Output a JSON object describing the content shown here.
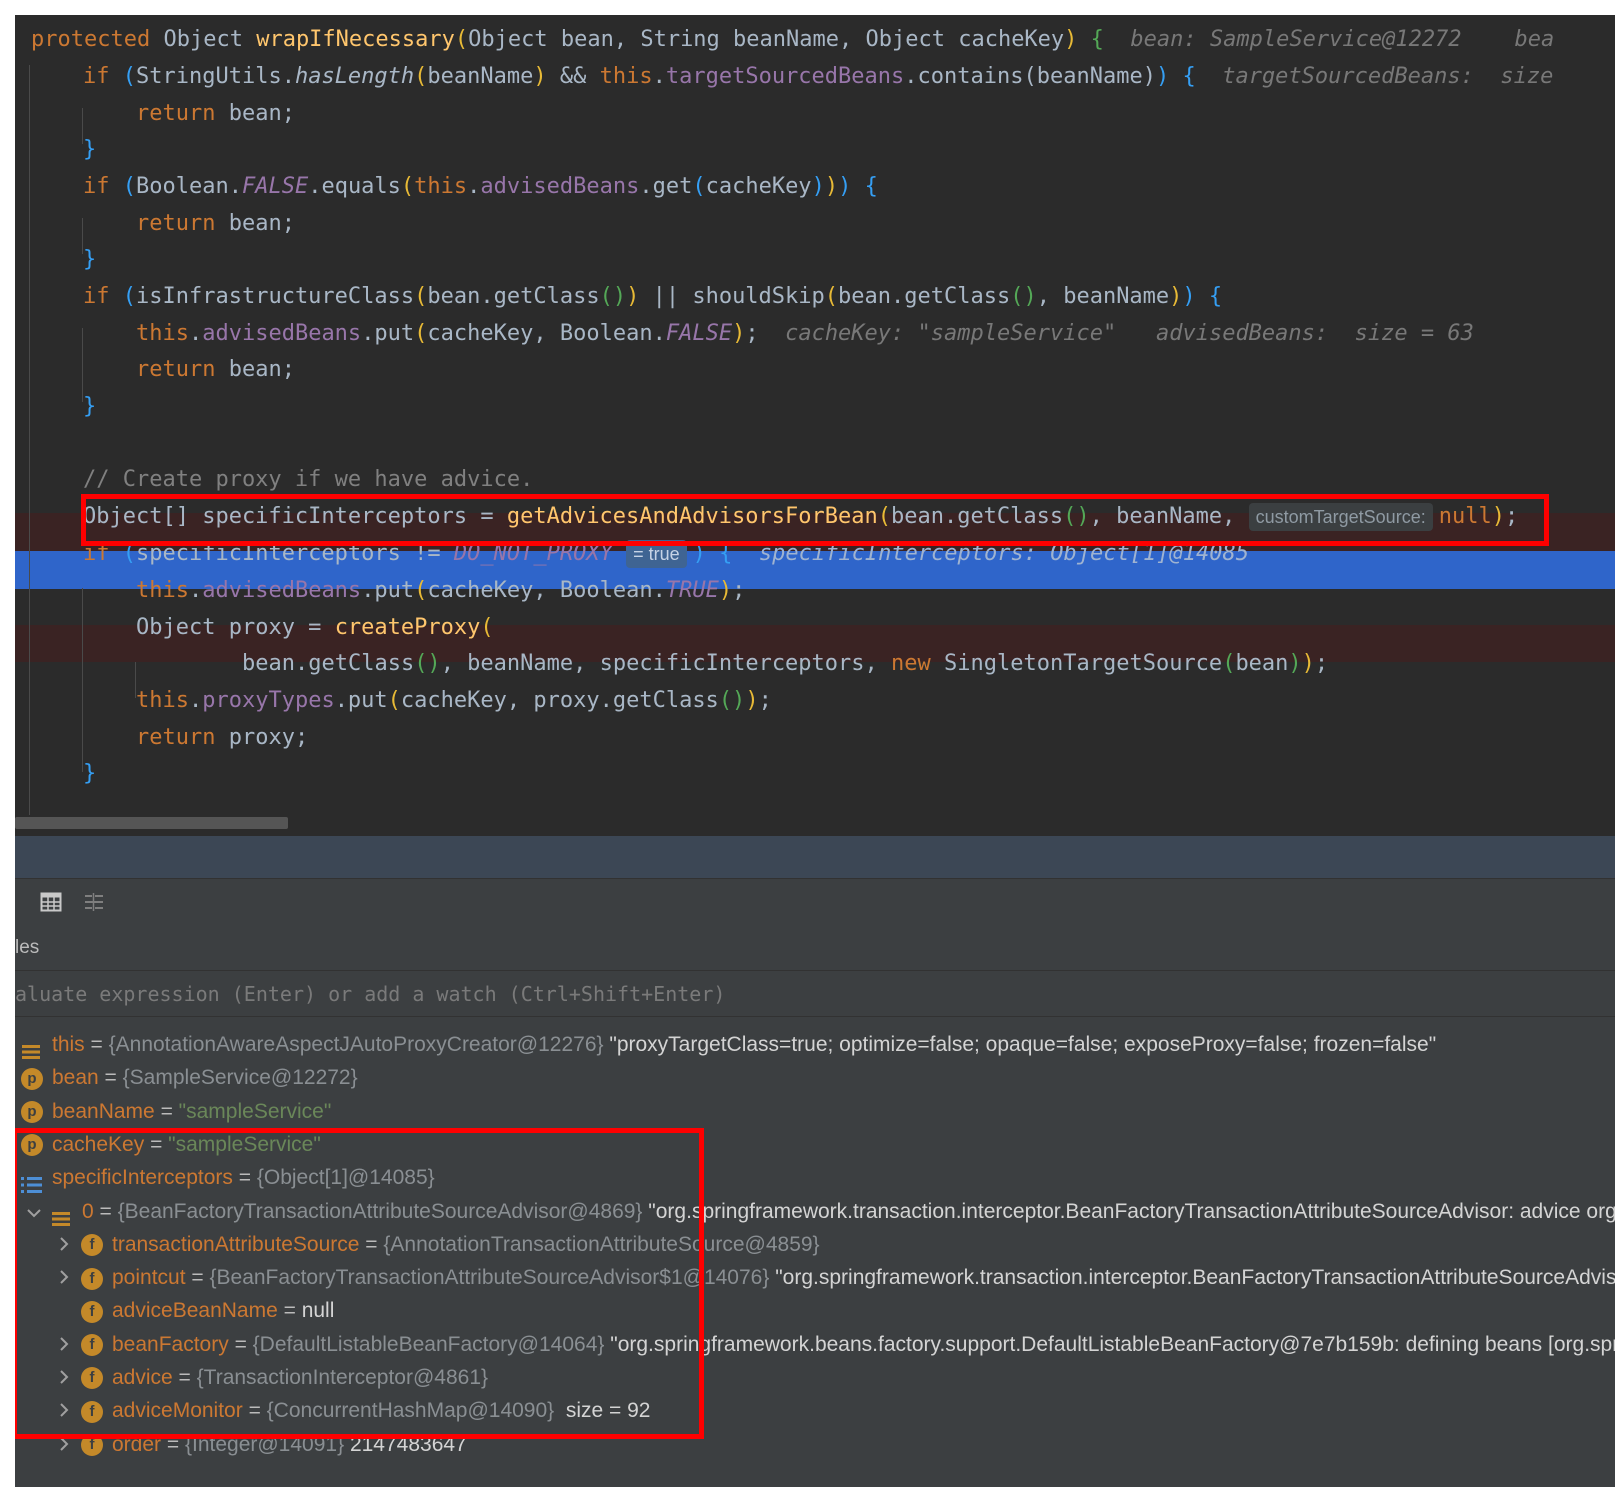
{
  "editor": {
    "line_method": {
      "kw_protected": "protected",
      "type_object": "Object",
      "method_name": "wrapIfNecessary",
      "params": "Object bean, String beanName, Object cacheKey",
      "open": "{",
      "hint_bean": "bean: SampleService@12272",
      "hint_more": "bea"
    },
    "line_if1": {
      "kw_if": "if",
      "cls": "StringUtils.",
      "method": "hasLength",
      "arg": "beanName",
      "andand": " && ",
      "this": "this",
      "field": "targetSourcedBeans",
      "call": ".contains(",
      "arg2": "beanName",
      "hint": "targetSourcedBeans:  size"
    },
    "return_kw": "return",
    "return_bean": " bean;",
    "return_proxy": " proxy;",
    "close_brace": "}",
    "line_if2": {
      "kw_if": "if",
      "cls": "Boolean.",
      "const_false": "FALSE",
      "equals": ".equals",
      "this": "this",
      "field": "advisedBeans",
      "get": ".get",
      "arg": "cacheKey"
    },
    "line_if3": {
      "kw_if": "if",
      "m1": "isInfrastructureClass",
      "getclass": "bean.getClass",
      "or": " || ",
      "m2": "shouldSkip",
      "sep": ", beanName"
    },
    "line_put_false": {
      "this": "this",
      "field": "advisedBeans",
      "put": ".put",
      "args": "cacheKey, Boolean.",
      "const": "FALSE",
      "hint1": "cacheKey: \"sampleService\"",
      "hint2": "advisedBeans:  size = 63"
    },
    "comment": "// Create proxy if we have advice.",
    "line_specific": {
      "decl": "Object[] specificInterceptors = ",
      "method": "getAdvicesAndAdvisorsForBean",
      "args": "bean.getClass",
      "args2": "beanName",
      "param_hint": "customTargetSource:",
      "null_kw": "null",
      "end": ";"
    },
    "line_if4": {
      "kw_if": "if",
      "var": "specificInterceptors != ",
      "const": "DO_NOT_PROXY",
      "eval_pill": "= true",
      "open": "{",
      "hint": "specificInterceptors: Object[1]@14085"
    },
    "line_put_true": {
      "this": "this",
      "field": "advisedBeans",
      "put": ".put",
      "args": "cacheKey, Boolean.",
      "const": "TRUE"
    },
    "line_create": {
      "decl": "Object proxy = ",
      "method": "createProxy"
    },
    "line_create_args": {
      "a1": "bean.getClass",
      "a2": ", beanName, specificInterceptors, ",
      "new_kw": "new",
      "cls": " SingletonTargetSource",
      "arg": "bean"
    },
    "line_proxytypes": {
      "this": "this",
      "field": "proxyTypes",
      "put": ".put",
      "a1": "cacheKey, proxy.getClass"
    }
  },
  "debugger": {
    "tab_label": "les",
    "eval_placeholder": "aluate expression (Enter) or add a watch (Ctrl+Shift+Enter)",
    "variables": [
      {
        "name": "this",
        "type": "{AnnotationAwareAspectJAutoProxyCreator@12276}",
        "value": "\"proxyTargetClass=true; optimize=false; opaque=false; exposeProxy=false; frozen=false\"",
        "icon": "lines-icon"
      },
      {
        "name": "bean",
        "type": "{SampleService@12272}",
        "value": "",
        "icon": "p-badge",
        "badge": "p"
      },
      {
        "name": "beanName",
        "type": "",
        "value": "\"sampleService\"",
        "icon": "p-badge",
        "badge": "p"
      },
      {
        "name": "cacheKey",
        "type": "",
        "value": "\"sampleService\"",
        "icon": "p-badge",
        "badge": "p"
      },
      {
        "name": "specificInterceptors",
        "type": "{Object[1]@14085}",
        "value": "",
        "icon": "array-icon"
      },
      {
        "name": "0",
        "type": "{BeanFactoryTransactionAttributeSourceAdvisor@4869}",
        "value": "\"org.springframework.transaction.interceptor.BeanFactoryTransactionAttributeSourceAdvisor: advice org.s",
        "icon": "lines-icon"
      },
      {
        "name": "transactionAttributeSource",
        "type": "{AnnotationTransactionAttributeSource@4859}",
        "value": "",
        "icon": "f-badge",
        "badge": "f"
      },
      {
        "name": "pointcut",
        "type": "{BeanFactoryTransactionAttributeSourceAdvisor$1@14076}",
        "value": "\"org.springframework.transaction.interceptor.BeanFactoryTransactionAttributeSourceAdviso",
        "icon": "f-badge",
        "badge": "f"
      },
      {
        "name": "adviceBeanName",
        "type": "",
        "value": "null",
        "icon": "f-badge",
        "badge": "f"
      },
      {
        "name": "beanFactory",
        "type": "{DefaultListableBeanFactory@14064}",
        "value": "\"org.springframework.beans.factory.support.DefaultListableBeanFactory@7e7b159b: defining beans [org.spri",
        "icon": "f-badge",
        "badge": "f"
      },
      {
        "name": "advice",
        "type": "{TransactionInterceptor@4861}",
        "value": "",
        "icon": "f-badge",
        "badge": "f"
      },
      {
        "name": "adviceMonitor",
        "type": "{ConcurrentHashMap@14090}",
        "value": " size = 92",
        "icon": "f-badge",
        "badge": "f"
      },
      {
        "name": "order",
        "type": "{Integer@14091}",
        "value": "2147483647",
        "icon": "f-badge",
        "badge": "f"
      }
    ],
    "eq": " = "
  },
  "colors": {
    "editor_bg": "#2b2b2b",
    "keyword": "#cc7832",
    "method": "#ffc66d",
    "field": "#9876aa",
    "selected_line": "#2f65ca",
    "breakpoint_line": "#3a2323",
    "annotation_red": "#ff0000"
  }
}
